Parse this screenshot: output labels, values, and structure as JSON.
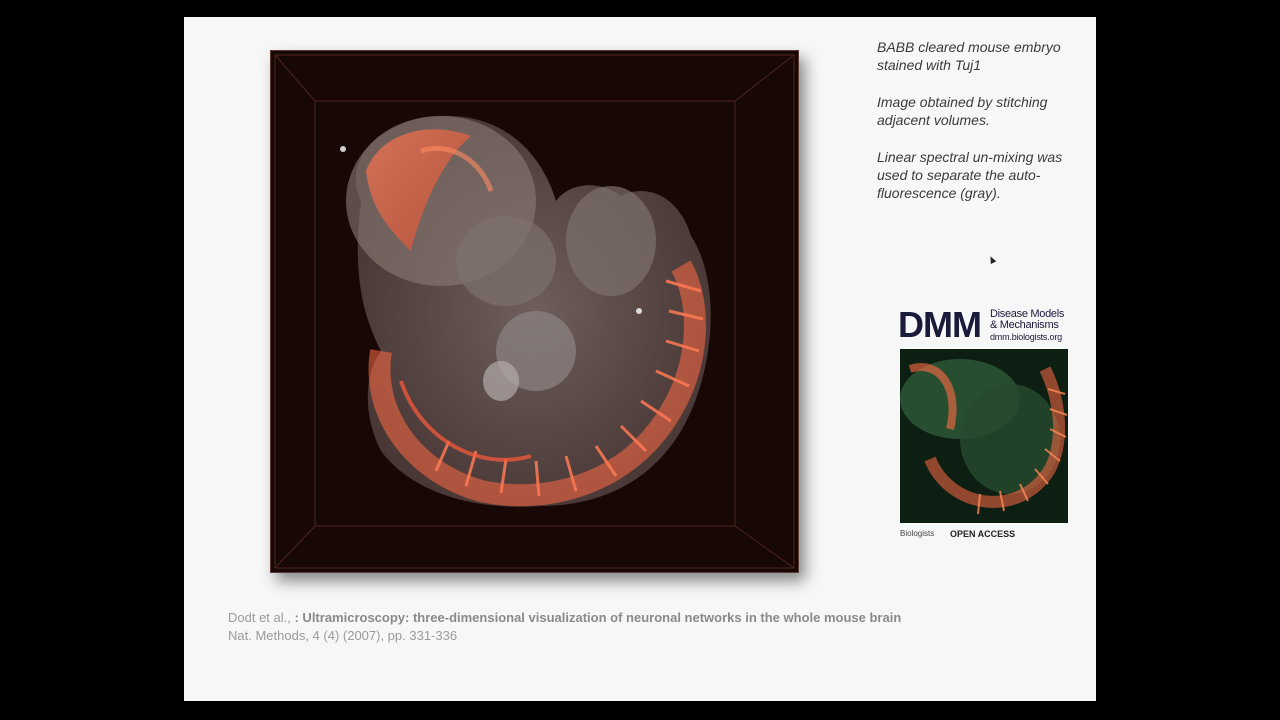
{
  "side_text": {
    "line1": "BABB cleared mouse embryo stained with Tuj1",
    "line2": "Image obtained by stitching adjacent volumes.",
    "line3": "Linear spectral un-mixing was used to separate the auto-fluorescence (gray)."
  },
  "journal": {
    "logo": "DMM",
    "name": "Disease Models & Mechanisms",
    "url": "dmm.biologists.org",
    "publisher": "Biologists",
    "access": "OPEN ACCESS"
  },
  "citation": {
    "authors": "Dodt et al., ",
    "title": ": Ultramicroscopy: three-dimensional visualization of neuronal networks in the whole mouse brain",
    "source": "Nat. Methods, 4 (4) (2007), pp. 331-336"
  },
  "colors": {
    "stain": "#ff6a45",
    "autofluorescence": "#8a8a8a",
    "slide_bg": "#f7f7f7"
  }
}
